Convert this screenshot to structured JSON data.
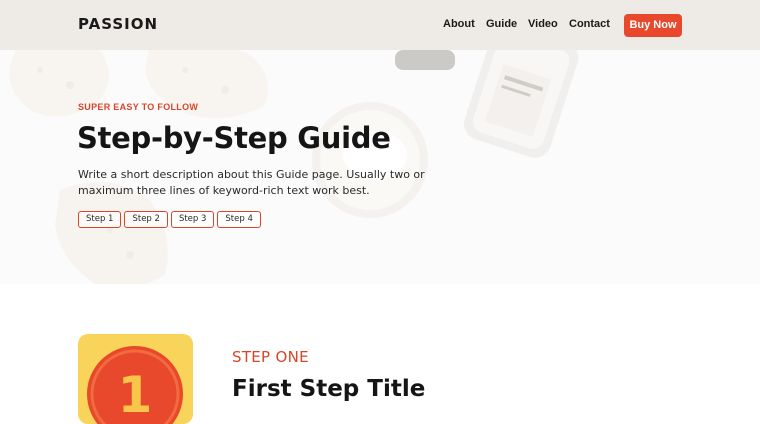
{
  "header": {
    "logo": "PASSION",
    "nav": [
      "About",
      "Guide",
      "Video",
      "Contact"
    ],
    "cta": "Buy Now"
  },
  "hero": {
    "eyebrow": "SUPER EASY TO FOLLOW",
    "title": "Step-by-Step Guide",
    "description": "Write a short description about this Guide page. Usually two or maximum three lines of keyword-rich text work best.",
    "steps": [
      "Step 1",
      "Step 2",
      "Step 3",
      "Step 4"
    ]
  },
  "step_section": {
    "icon_number": "1",
    "label": "STEP ONE",
    "title": "First Step Title"
  },
  "colors": {
    "accent": "#e8492c",
    "header_bg": "#eeeae5",
    "icon_bg": "#f8d45a"
  }
}
